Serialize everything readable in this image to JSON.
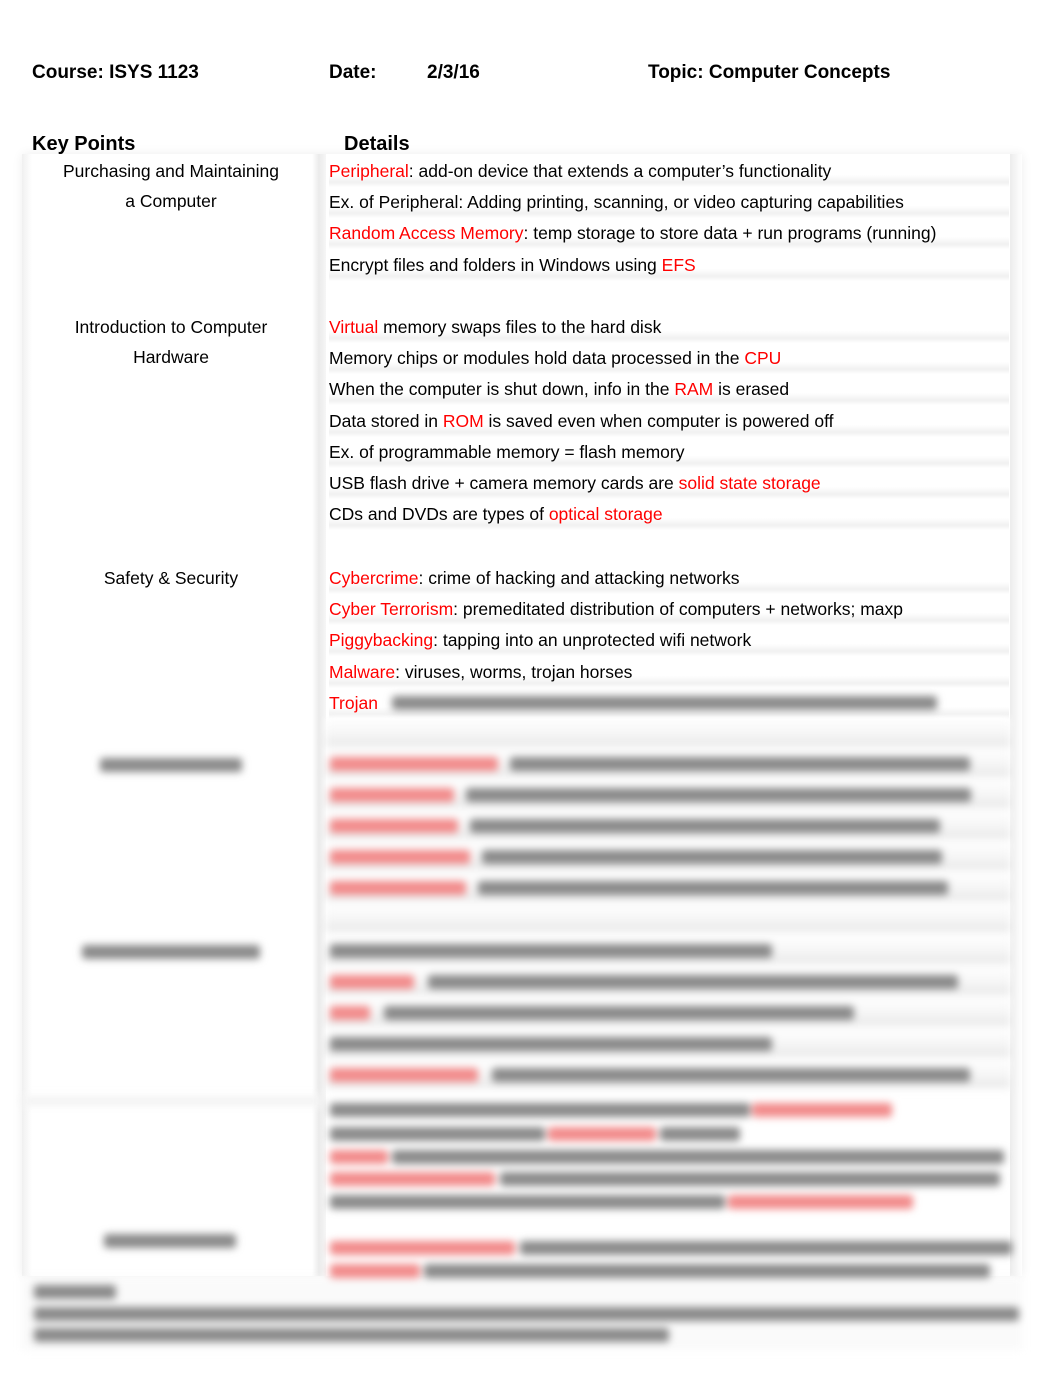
{
  "header": {
    "course": "Course: ISYS 1123",
    "date_label": "Date:",
    "date_value": "2/3/16",
    "topic": "Topic: Computer Concepts"
  },
  "columns": {
    "key_points": "Key Points",
    "details": "Details"
  },
  "colors": {
    "term": "#ff0000",
    "text": "#000000"
  },
  "sections": [
    {
      "key_point": [
        "Purchasing and Maintaining",
        "a Computer"
      ],
      "details": [
        {
          "term": "Peripheral",
          "text": ": add-on device that extends a computer’s functionality",
          "term_first": true
        },
        {
          "term": "",
          "text": "Ex. of Peripheral: Adding printing, scanning, or video capturing capabilities",
          "term_first": true
        },
        {
          "term": "Random Access Memory",
          "text": ": temp storage to store data + run programs (running)",
          "term_first": true
        },
        {
          "pre": "Encrypt files and folders in Windows using ",
          "term": "EFS",
          "text": ""
        }
      ]
    },
    {
      "key_point": [
        "Introduction to Computer",
        "Hardware"
      ],
      "details": [
        {
          "term": "Virtual",
          "text": " memory swaps files to the hard disk",
          "term_first": true
        },
        {
          "pre": "Memory chips or modules hold data processed in the ",
          "term": "CPU",
          "text": ""
        },
        {
          "pre": "When the computer is shut down, info in the ",
          "term": "RAM",
          "text": " is erased"
        },
        {
          "pre": "Data stored in ",
          "term": "ROM",
          "text": " is saved even when computer is powered off"
        },
        {
          "term": "",
          "text": "Ex. of programmable memory = flash memory",
          "term_first": true
        },
        {
          "pre": "USB flash drive + camera memory cards are ",
          "term": "solid state storage",
          "text": ""
        },
        {
          "pre": "CDs and DVDs are types of ",
          "term": "optical storage",
          "text": ""
        }
      ]
    },
    {
      "key_point": [
        "Safety & Security"
      ],
      "details": [
        {
          "term": "Cybercrime",
          "text": ": crime of hacking and attacking networks",
          "term_first": true
        },
        {
          "term": "Cyber Terrorism",
          "text": ": premeditated distribution of computers + networks; maxp",
          "term_first": true
        },
        {
          "term": "Piggybacking",
          "text": ": tapping into an unprotected wifi network",
          "term_first": true
        },
        {
          "term": "Malware",
          "text": ": viruses, worms, trojan horses",
          "term_first": true
        },
        {
          "term": "Trojan",
          "text": "",
          "term_first": true
        }
      ]
    }
  ],
  "obscured": {
    "note": "Remaining content is blurred and not legible",
    "blurred_sections": 4,
    "has_summary": true
  }
}
